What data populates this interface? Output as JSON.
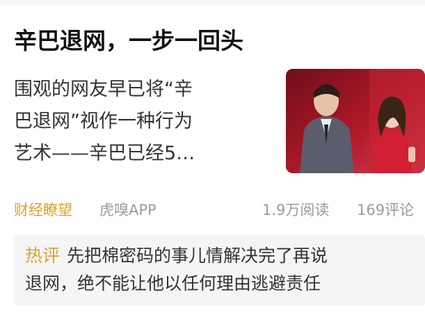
{
  "article": {
    "title": "辛巴退网，一步一回头",
    "snippet_lines": [
      "围观的网友早已将“辛",
      "巴退网”视作一种行为",
      "艺术——辛巴已经5…"
    ],
    "thumbnail_icon": "photo-thumbnail"
  },
  "meta": {
    "channel": "财经瞭望",
    "source": "虎嗅APP",
    "reads": "1.9万阅读",
    "comments": "169评论"
  },
  "hot_comment": {
    "label": "热评",
    "line1": "先把棉密码的事儿情解决完了再说",
    "line2": "退网，绝不能让他以任何理由逃避责任"
  },
  "colors": {
    "accent": "#e1a12a",
    "muted": "#9a9a9a",
    "text": "#333333",
    "title": "#111111",
    "panel": "#f5f5f5"
  }
}
